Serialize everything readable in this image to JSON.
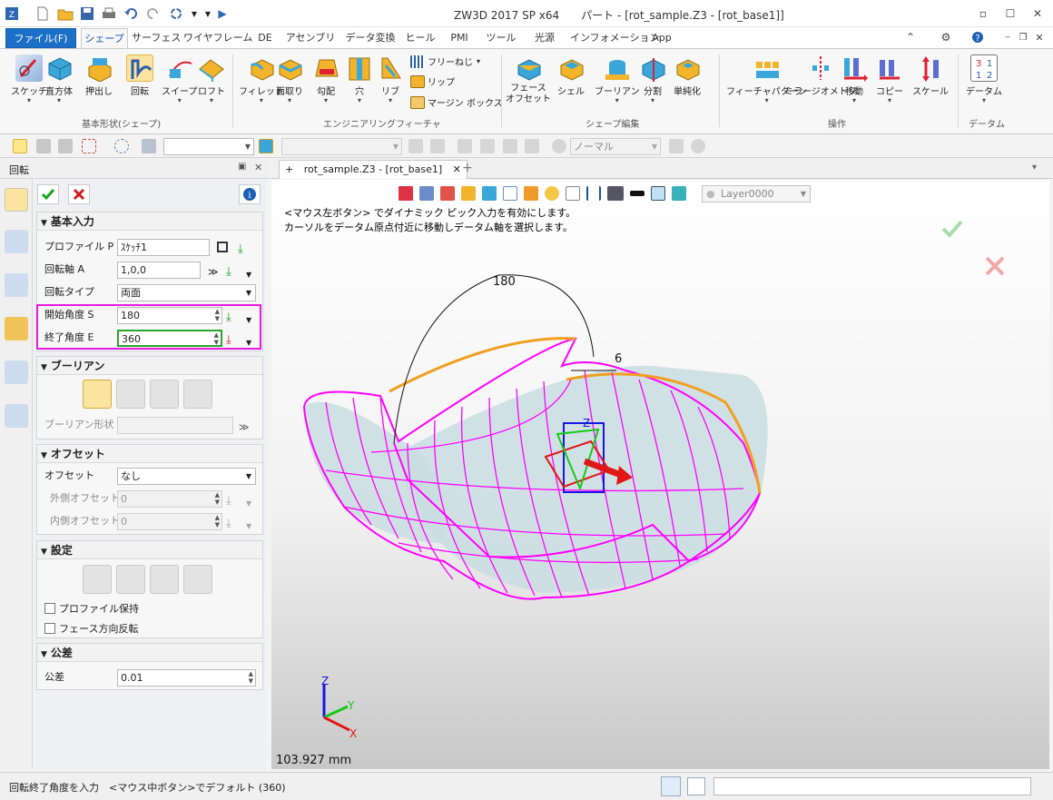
{
  "app": {
    "title": "ZW3D 2017 SP x64　　パート - [rot_sample.Z3 - [rot_base1]]"
  },
  "colors": {
    "file_tab": "#1c6fc7",
    "highlight_box": "#e91ae0",
    "active_field": "#2aa52a",
    "model_wire": "#ff00ff",
    "model_fill": "#c9dde2",
    "edge_orange": "#f0a020"
  },
  "menu": {
    "tabs": [
      "ファイル(F)",
      "シェープ",
      "サーフェス",
      "ワイヤフレーム",
      "DE",
      "アセンブリ",
      "データ変換",
      "ヒール",
      "PMI",
      "ツール",
      "光源",
      "インフォメーション",
      "App"
    ]
  },
  "ribbon": {
    "basic": {
      "group_label": "基本形状(シェープ)",
      "buttons": [
        "スケッチ",
        "直方体",
        "押出し",
        "回転",
        "スイープ",
        "ロフト"
      ]
    },
    "engineering": {
      "group_label": "エンジニアリングフィーチャ",
      "buttons": [
        "フィレット",
        "面取り",
        "勾配",
        "穴",
        "リブ"
      ],
      "small": [
        "フリーねじ",
        "リップ",
        "マージン ボックス"
      ]
    },
    "shape_edit": {
      "group_label": "シェープ編集",
      "buttons": [
        "フェース\nオフセット",
        "シェル",
        "ブーリアン",
        "分割",
        "単純化"
      ]
    },
    "operations": {
      "group_label": "操作",
      "buttons": [
        "フィーチャパターン",
        "ミラージオメトリ",
        "移動",
        "コピー",
        "スケール"
      ]
    },
    "datum": {
      "group_label": "データム",
      "buttons": [
        "データム"
      ]
    }
  },
  "toolbar2": {
    "display_mode": "ノーマル"
  },
  "panel": {
    "title": "回転",
    "sections": {
      "basic": {
        "title": "基本入力",
        "profile_label": "プロファイル P",
        "profile_value": "ｽｹｯﾁ1",
        "axis_label": "回転軸 A",
        "axis_value": "1,0,0",
        "type_label": "回転タイプ",
        "type_value": "両面",
        "start_label": "開始角度 S",
        "start_value": "180",
        "end_label": "終了角度 E",
        "end_value": "360"
      },
      "boolean": {
        "title": "ブーリアン",
        "shape_label": "ブーリアン形状"
      },
      "offset": {
        "title": "オフセット",
        "offset_label": "オフセット",
        "offset_value": "なし",
        "outer_label": "外側オフセット",
        "outer_value": "0",
        "inner_label": "内側オフセット",
        "inner_value": "0"
      },
      "settings": {
        "title": "設定",
        "keep_profile": "プロファイル保持",
        "reverse_face": "フェース方向反転"
      },
      "tolerance": {
        "title": "公差",
        "label": "公差",
        "value": "0.01"
      }
    }
  },
  "document": {
    "tab_label": "rot_sample.Z3 - [rot_base1]",
    "layer": "Layer0000",
    "message_line1": "<マウス左ボタン> でダイナミック ピック入力を有効にします。",
    "message_line2": "カーソルをデータム原点付近に移動しデータム軸を選択します。",
    "dim_180": "180",
    "dim_6": "6",
    "distance": "103.927 mm",
    "triad": {
      "x": "X",
      "y": "Y",
      "z": "Z"
    }
  },
  "status": {
    "prompt": "回転終了角度を入力　<マウス中ボタン>でデフォルト (360)"
  }
}
